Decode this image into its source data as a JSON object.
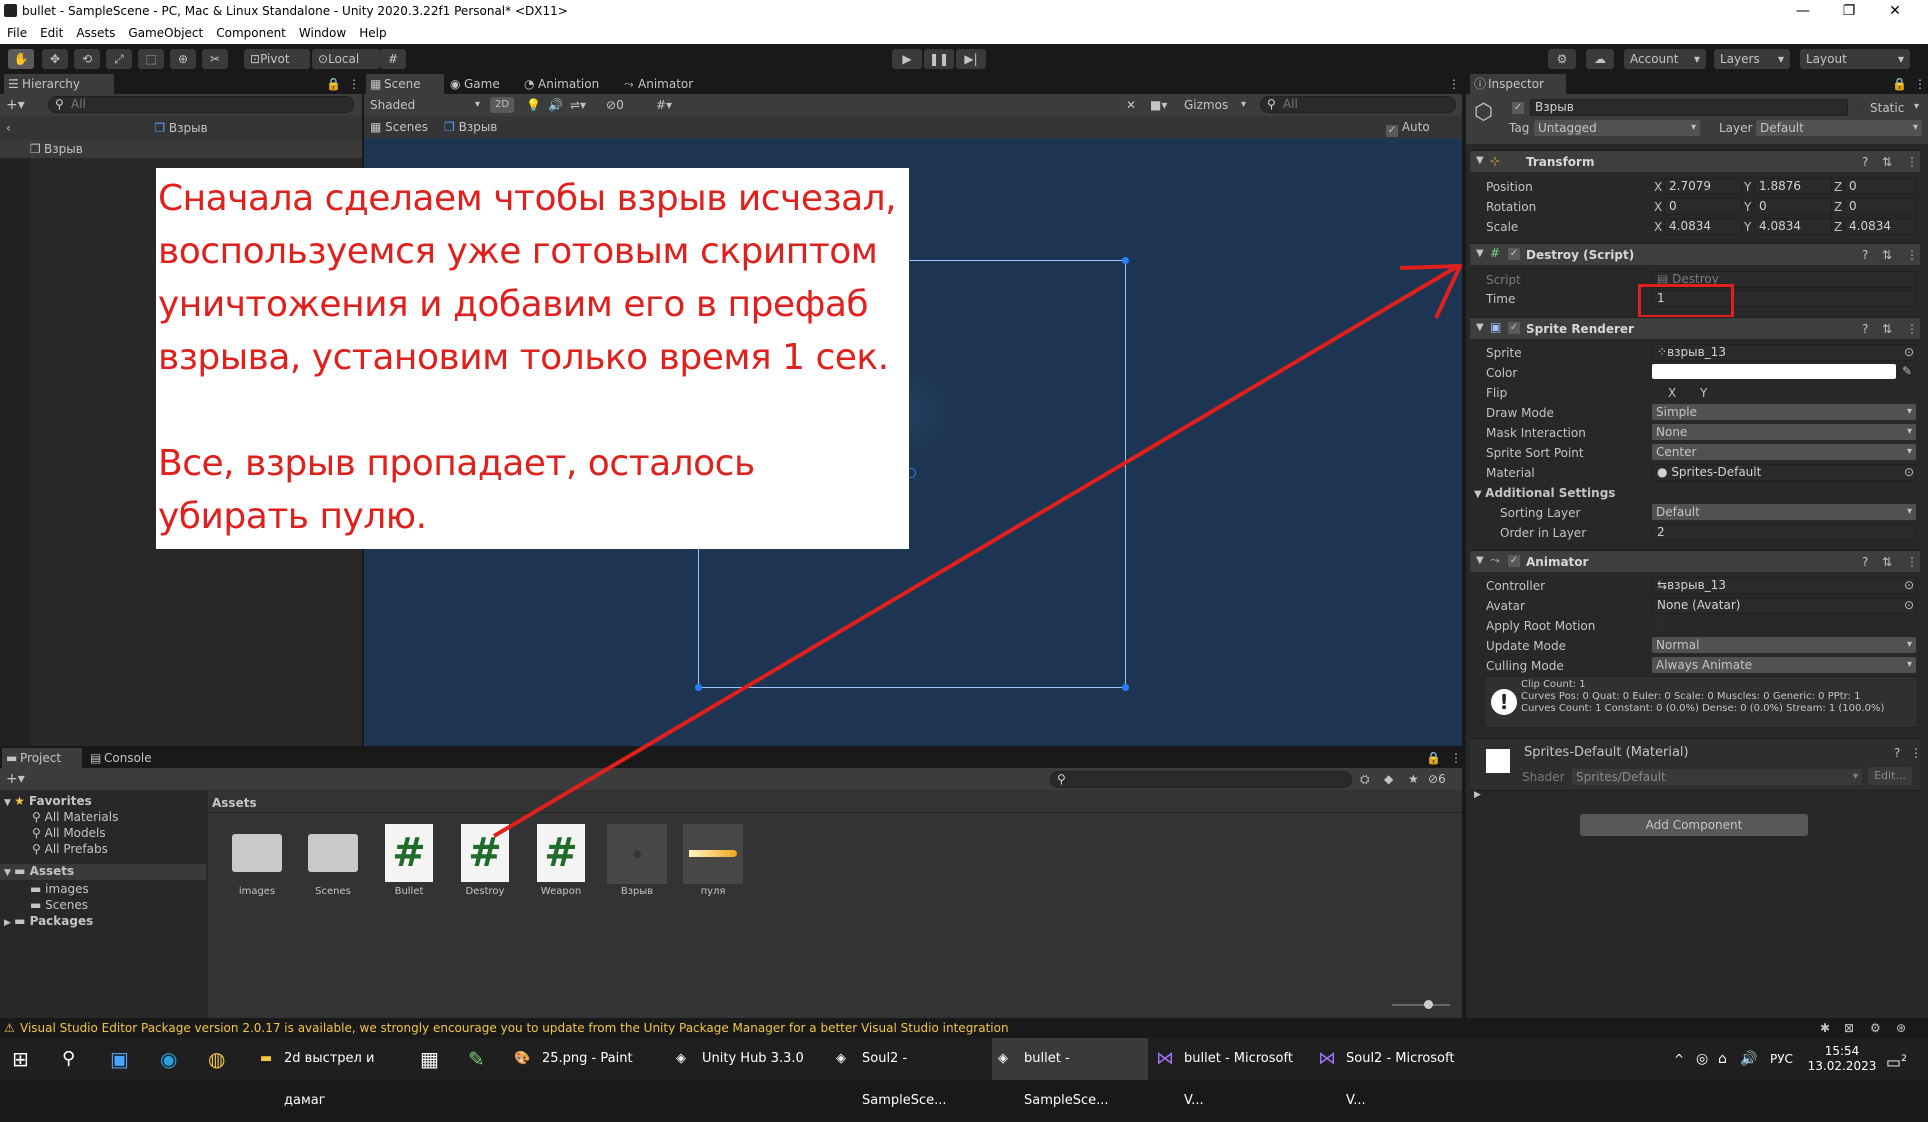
{
  "window": {
    "title": "bullet - SampleScene - PC, Mac & Linux Standalone - Unity 2020.3.22f1 Personal* <DX11>",
    "minimize": "—",
    "maximize": "❐",
    "close": "✕"
  },
  "menu": [
    "File",
    "Edit",
    "Assets",
    "GameObject",
    "Component",
    "Window",
    "Help"
  ],
  "toolbar": {
    "pivot": "Pivot",
    "local": "Local",
    "account": "Account",
    "layers": "Layers",
    "layout": "Layout"
  },
  "hierarchy": {
    "tab": "Hierarchy",
    "search": "All",
    "scene_name": "Взрыв",
    "item": "Взрыв"
  },
  "scene": {
    "tabs": [
      "Scene",
      "Game",
      "Animation",
      "Animator"
    ],
    "shading": "Shaded",
    "mode2d": "2D",
    "hidden_count": "0",
    "gizmos": "Gizmos",
    "search": "All",
    "breadcrumb_root": "Scenes",
    "breadcrumb_item": "Взрыв",
    "autosave": "Auto Save"
  },
  "annotation": {
    "para1": "Сначала сделаем чтобы взрыв исчезал, воспользуемся уже готовым скриптом уничтожения и добавим его в префаб взрыва, установим только время 1 сек.",
    "para2": "Все, взрыв пропадает, осталось убирать пулю.",
    "color": "#e0201c"
  },
  "inspector": {
    "tab": "Inspector",
    "object_name": "Взрыв",
    "static_label": "Static",
    "tag_label": "Tag",
    "tag": "Untagged",
    "layer_label": "Layer",
    "layer": "Default",
    "transform": {
      "title": "Transform",
      "position": {
        "label": "Position",
        "x": "2.7079",
        "y": "1.8876",
        "z": "0"
      },
      "rotation": {
        "label": "Rotation",
        "x": "0",
        "y": "0",
        "z": "0"
      },
      "scale": {
        "label": "Scale",
        "x": "4.0834",
        "y": "4.0834",
        "z": "4.0834"
      }
    },
    "destroy": {
      "title": "Destroy (Script)",
      "script_label": "Script",
      "script": "Destroy",
      "time_label": "Time",
      "time": "1"
    },
    "sprite_renderer": {
      "title": "Sprite Renderer",
      "sprite_label": "Sprite",
      "sprite": "взрыв_13",
      "color_label": "Color",
      "flip_label": "Flip",
      "flip_x": "X",
      "flip_y": "Y",
      "draw_mode_label": "Draw Mode",
      "draw_mode": "Simple",
      "mask_label": "Mask Interaction",
      "mask": "None",
      "sort_point_label": "Sprite Sort Point",
      "sort_point": "Center",
      "material_label": "Material",
      "material": "Sprites-Default",
      "additional": "Additional Settings",
      "sorting_layer_label": "Sorting Layer",
      "sorting_layer": "Default",
      "order_label": "Order in Layer",
      "order": "2"
    },
    "animator": {
      "title": "Animator",
      "controller_label": "Controller",
      "controller": "взрыв_13",
      "avatar_label": "Avatar",
      "avatar": "None (Avatar)",
      "root_motion_label": "Apply Root Motion",
      "update_label": "Update Mode",
      "update": "Normal",
      "culling_label": "Culling Mode",
      "culling": "Always Animate",
      "info1": "Clip Count: 1",
      "info2": "Curves Pos: 0 Quat: 0 Euler: 0 Scale: 0 Muscles: 0 Generic: 0 PPtr: 1",
      "info3": "Curves Count: 1 Constant: 0 (0.0%) Dense: 0 (0.0%) Stream: 1 (100.0%)"
    },
    "material": {
      "title": "Sprites-Default (Material)",
      "shader_label": "Shader",
      "shader": "Sprites/Default",
      "edit": "Edit..."
    },
    "add_component": "Add Component"
  },
  "project": {
    "tabs": [
      "Project",
      "Console"
    ],
    "hidden_count": "6",
    "favorites": "Favorites",
    "fav_items": [
      "All Materials",
      "All Models",
      "All Prefabs"
    ],
    "assets_root": "Assets",
    "asset_folders": [
      "images",
      "Scenes"
    ],
    "packages": "Packages",
    "breadcrumb": "Assets",
    "assets": [
      {
        "name": "images",
        "icon": "folder-icon"
      },
      {
        "name": "Scenes",
        "icon": "folder-icon"
      },
      {
        "name": "Bullet",
        "icon": "script-icon"
      },
      {
        "name": "Destroy",
        "icon": "script-icon"
      },
      {
        "name": "Weapon",
        "icon": "script-icon"
      },
      {
        "name": "Взрыв",
        "icon": "prefab-icon"
      },
      {
        "name": "пуля",
        "icon": "bullet-sprite-icon"
      }
    ]
  },
  "statusbar": "Visual Studio Editor Package version 2.0.17 is available, we strongly encourage you to update from the Unity Package Manager for a better Visual Studio integration",
  "taskbar": {
    "items": [
      "2d выстрел и дамаг",
      "25.png - Paint",
      "Unity Hub 3.3.0",
      "Soul2 - SampleSce...",
      "bullet - SampleSce...",
      "bullet - Microsoft V...",
      "Soul2 - Microsoft V..."
    ],
    "lang": "РУС",
    "time": "15:54",
    "date": "13.02.2023",
    "notif": "2"
  }
}
